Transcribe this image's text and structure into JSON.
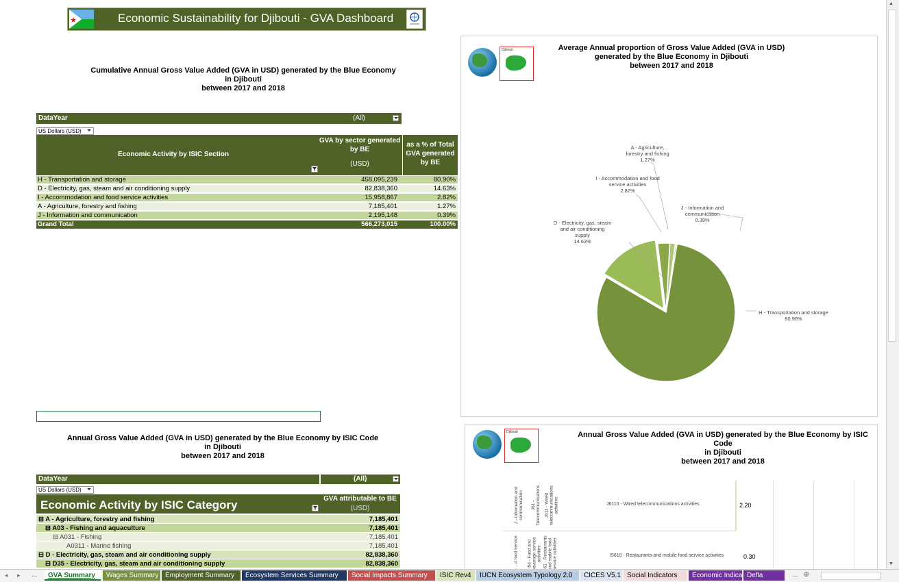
{
  "banner": {
    "title": "Economic Sustainability for Djibouti - GVA Dashboard"
  },
  "pivot1": {
    "title_lines": [
      "Cumulative Annual Gross Value Added (GVA in USD) generated  by the Blue Economy",
      "in Djibouti",
      "between 2017 and 2018"
    ],
    "filter_label": "DataYear",
    "filter_value": "(All)",
    "currency": "US Dollars (USD)",
    "col_activity": "Economic Activity by ISIC Section",
    "col_gva": "GVA by sector generated by BE",
    "col_gva_unit": "(USD)",
    "col_pct": "as a % of Total GVA generated by BE",
    "rows": [
      {
        "label": "H - Transportation and storage",
        "gva": "458,095,239",
        "pct": "80.90%"
      },
      {
        "label": "D - Electricity, gas, steam and air conditioning supply",
        "gva": "82,838,360",
        "pct": "14.63%"
      },
      {
        "label": "I - Accommodation and food service activities",
        "gva": "15,958,867",
        "pct": "2.82%"
      },
      {
        "label": "A - Agriculture, forestry and fishing",
        "gva": "7,185,401",
        "pct": "1.27%"
      },
      {
        "label": "J - Information and communication",
        "gva": "2,195,148",
        "pct": "0.39%"
      }
    ],
    "total": {
      "label": "Grand Total",
      "gva": "566,273,015",
      "pct": "100.00%"
    }
  },
  "pie_panel": {
    "title_lines": [
      "Average Annual proportion of Gross Value Added (GVA in USD)",
      "generated by the Blue Economy in Djibouti",
      "between 2017 and 2018"
    ],
    "map_label": "Djibouti",
    "labels": {
      "h": [
        "H - Transportation and storage",
        "80.90%"
      ],
      "d": [
        "D - Electricity, gas, steam",
        "and air conditioning",
        "supply",
        "14.63%"
      ],
      "i": [
        "I - Accommodation and food",
        "service activities",
        "2.82%"
      ],
      "a": [
        "A - Agriculture,",
        "forestry and fishing",
        "1.27%"
      ],
      "j": [
        "J - Information and",
        "communication",
        "0.39%"
      ]
    },
    "colors": {
      "h": "#76923c",
      "d": "#9bbb59",
      "i": "#8aa84a",
      "a": "#aec77a",
      "j": "#c4d79b"
    }
  },
  "chart_data": {
    "type": "pie",
    "title": "Average Annual proportion of Gross Value Added (GVA in USD) generated by the Blue Economy in Djibouti between 2017 and 2018",
    "categories": [
      "H - Transportation and storage",
      "D - Electricity, gas, steam and air conditioning supply",
      "I - Accommodation and food service activities",
      "A - Agriculture, forestry and fishing",
      "J - Information and communication"
    ],
    "values": [
      80.9,
      14.63,
      2.82,
      1.27,
      0.39
    ]
  },
  "pivot2": {
    "title_lines": [
      "Annual Gross Value Added (GVA in USD) generated  by the Blue Economy by ISIC Code",
      "in Djibouti",
      "between 2017 and 2018"
    ],
    "filter_label": "DataYear",
    "filter_value": "(All)",
    "currency": "US Dollars (USD)",
    "col_activity": "Economic Activity by ISIC Category",
    "col_gva": "GVA attributable to BE",
    "col_gva_unit": "(USD)",
    "rows": [
      {
        "label": "⊟ A - Agriculture, forestry and fishing",
        "value": "7,185,401",
        "level": 0
      },
      {
        "label": "⊟ A03 - Fishing and aquaculture",
        "value": "7,185,401",
        "level": 1
      },
      {
        "label": "⊟ A031 - Fishing",
        "value": "7,185,401",
        "level": 2
      },
      {
        "label": "A0311 - Marine fishing",
        "value": "7,185,401",
        "level": 3
      },
      {
        "label": "⊟ D - Electricity, gas, steam and air conditioning supply",
        "value": "82,838,360",
        "level": 0
      },
      {
        "label": "⊟ D35 - Electricity, gas, steam and air conditioning supply",
        "value": "82,838,360",
        "level": 1
      }
    ]
  },
  "isic_panel": {
    "title_lines": [
      "Annual Gross Value Added (GVA in USD) generated  by the Blue Economy by ISIC Code",
      "in Djibouti",
      "between 2017 and 2018"
    ],
    "map_label": "Djibouti",
    "rows": [
      {
        "v1": "J - Information and communication",
        "v2": "J61 - Telecommunications",
        "v3": "J611 - Wired telecommunications activities",
        "label": "J6110 - Wired telecommunications activities",
        "value": "2.20"
      },
      {
        "v1": "I - ...d food service",
        "v2": "I56 - Food and beverage service activities",
        "v3": "I561 - Restaurants and mobile food service activities",
        "label": "I5610 - Restaurants and mobile food service activities",
        "value": "0.30"
      }
    ]
  },
  "tabs": [
    {
      "label": "GVA Summary",
      "bg": "#ffffff",
      "fg": "#1e6e2e"
    },
    {
      "label": "Wages Summary",
      "bg": "#76923c",
      "fg": "#ffffff"
    },
    {
      "label": "Employment Summary",
      "bg": "#4f6228",
      "fg": "#ffffff"
    },
    {
      "label": "Ecosystem Services Summary",
      "bg": "#1f3864",
      "fg": "#ffffff"
    },
    {
      "label": "Social Impacts Summary",
      "bg": "#c0504d",
      "fg": "#ffffff"
    },
    {
      "label": "ISIC Rev4",
      "bg": "#d7e4bc",
      "fg": "#000000"
    },
    {
      "label": "IUCN Ecosystem Typology 2.0",
      "bg": "#b8cce4",
      "fg": "#000000"
    },
    {
      "label": "CICES V5.1",
      "bg": "#dbe5f1",
      "fg": "#000000"
    },
    {
      "label": "Social Indicators",
      "bg": "#f2dcdb",
      "fg": "#000000"
    },
    {
      "label": "Economic Indicators",
      "bg": "#7030a0",
      "fg": "#ffffff"
    },
    {
      "label": "Defla",
      "bg": "#7030a0",
      "fg": "#ffffff"
    }
  ],
  "tab_nav": {
    "prev": "◂",
    "next": "▸",
    "more": "...",
    "more2": "...",
    "add": "⊕"
  }
}
